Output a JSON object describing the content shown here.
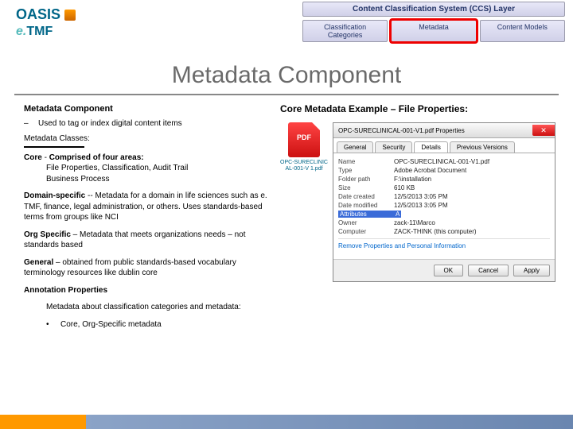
{
  "logos": {
    "oasis": "OASIS",
    "etmf_e": "e.",
    "etmf_rest": "TMF"
  },
  "ccs": {
    "top": "Content Classification System (CCS) Layer",
    "cells": [
      "Classification Categories",
      "Metadata",
      "Content Models"
    ]
  },
  "title": "Metadata Component",
  "left": {
    "heading": "Metadata Component",
    "bullet1": "Used to tag or index digital content items",
    "mc_label": "Metadata Classes:",
    "core_label": "Core",
    "core_dash": "-",
    "core_head": "Comprised of four areas:",
    "core_line1": "File Properties, Classification, Audit Trail",
    "core_line2": "Business Process",
    "domain_label": "Domain-specific",
    "domain_text": " -- Metadata for a domain in life sciences such as e. TMF, finance, legal administration, or others. Uses standards-based terms from groups like NCI",
    "org_label": "Org Specific",
    "org_text": " – Metadata that meets organizations needs – not standards based",
    "general_label": "General",
    "general_text": " – obtained from public standards-based vocabulary terminology resources like dublin core",
    "ann_head": "Annotation Properties",
    "ann_desc": "Metadata about classification categories and metadata:",
    "ann_bullet_mark": "•",
    "ann_bullet": "Core, Org-Specific metadata"
  },
  "right": {
    "heading": "Core Metadata Example – File Properties:",
    "thumb_label": "OPC-SURECLINICAL-001-V 1.pdf",
    "dialog": {
      "title": "OPC-SURECLINICAL-001-V1.pdf Properties",
      "tabs": [
        "General",
        "Security",
        "Details",
        "Previous Versions"
      ],
      "props": {
        "name": "OPC-SURECLINICAL-001-V1.pdf",
        "type": "Adobe Acrobat Document",
        "folder": "F:\\installation",
        "size": "610 KB",
        "created": "12/5/2013 3:05 PM",
        "modified": "12/5/2013 3:05 PM",
        "attributes": "A",
        "owner": "zack-11\\Marco",
        "computer": "ZACK-THINK (this computer)"
      },
      "labels": {
        "name": "Name",
        "type": "Type",
        "folder": "Folder path",
        "size": "Size",
        "created": "Date created",
        "modified": "Date modified",
        "attributes": "Attributes",
        "owner": "Owner",
        "computer": "Computer"
      },
      "link": "Remove Properties and Personal Information",
      "buttons": [
        "OK",
        "Cancel",
        "Apply"
      ]
    }
  }
}
